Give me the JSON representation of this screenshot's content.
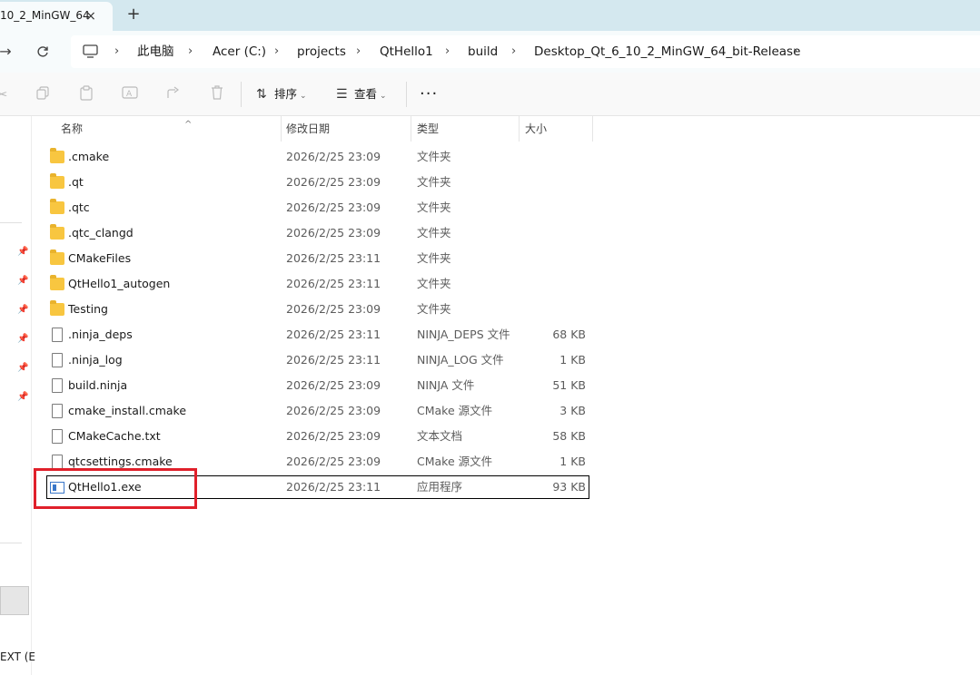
{
  "window": {
    "tab_title": "10_2_MinGW_64",
    "tab_close": "×",
    "new_tab": "+"
  },
  "nav": {
    "refresh_icon": "refresh-icon",
    "breadcrumbs": [
      "此电脑",
      "Acer (C:)",
      "projects",
      "QtHello1",
      "build",
      "Desktop_Qt_6_10_2_MinGW_64_bit-Release"
    ]
  },
  "toolbar": {
    "sort_label": "排序",
    "view_label": "查看",
    "more_label": "···"
  },
  "columns": {
    "name": "名称",
    "date": "修改日期",
    "type": "类型",
    "size": "大小"
  },
  "files": [
    {
      "name": ".cmake",
      "date": "2026/2/25 23:09",
      "type": "文件夹",
      "size": "",
      "kind": "folder"
    },
    {
      "name": ".qt",
      "date": "2026/2/25 23:09",
      "type": "文件夹",
      "size": "",
      "kind": "folder"
    },
    {
      "name": ".qtc",
      "date": "2026/2/25 23:09",
      "type": "文件夹",
      "size": "",
      "kind": "folder"
    },
    {
      "name": ".qtc_clangd",
      "date": "2026/2/25 23:09",
      "type": "文件夹",
      "size": "",
      "kind": "folder"
    },
    {
      "name": "CMakeFiles",
      "date": "2026/2/25 23:11",
      "type": "文件夹",
      "size": "",
      "kind": "folder"
    },
    {
      "name": "QtHello1_autogen",
      "date": "2026/2/25 23:11",
      "type": "文件夹",
      "size": "",
      "kind": "folder"
    },
    {
      "name": "Testing",
      "date": "2026/2/25 23:09",
      "type": "文件夹",
      "size": "",
      "kind": "folder"
    },
    {
      "name": ".ninja_deps",
      "date": "2026/2/25 23:11",
      "type": "NINJA_DEPS 文件",
      "size": "68 KB",
      "kind": "doc"
    },
    {
      "name": ".ninja_log",
      "date": "2026/2/25 23:11",
      "type": "NINJA_LOG 文件",
      "size": "1 KB",
      "kind": "doc"
    },
    {
      "name": "build.ninja",
      "date": "2026/2/25 23:09",
      "type": "NINJA 文件",
      "size": "51 KB",
      "kind": "doc"
    },
    {
      "name": "cmake_install.cmake",
      "date": "2026/2/25 23:09",
      "type": "CMake 源文件",
      "size": "3 KB",
      "kind": "doc"
    },
    {
      "name": "CMakeCache.txt",
      "date": "2026/2/25 23:09",
      "type": "文本文档",
      "size": "58 KB",
      "kind": "doc"
    },
    {
      "name": "qtcsettings.cmake",
      "date": "2026/2/25 23:09",
      "type": "CMake 源文件",
      "size": "1 KB",
      "kind": "doc"
    },
    {
      "name": "QtHello1.exe",
      "date": "2026/2/25 23:11",
      "type": "应用程序",
      "size": "93 KB",
      "kind": "exe"
    }
  ],
  "sidebar": {
    "bottom_text": "EXT (E"
  },
  "colors": {
    "highlight_box": "#e0202a",
    "folder": "#f8c640",
    "tabbar": "#d4e8ef"
  }
}
